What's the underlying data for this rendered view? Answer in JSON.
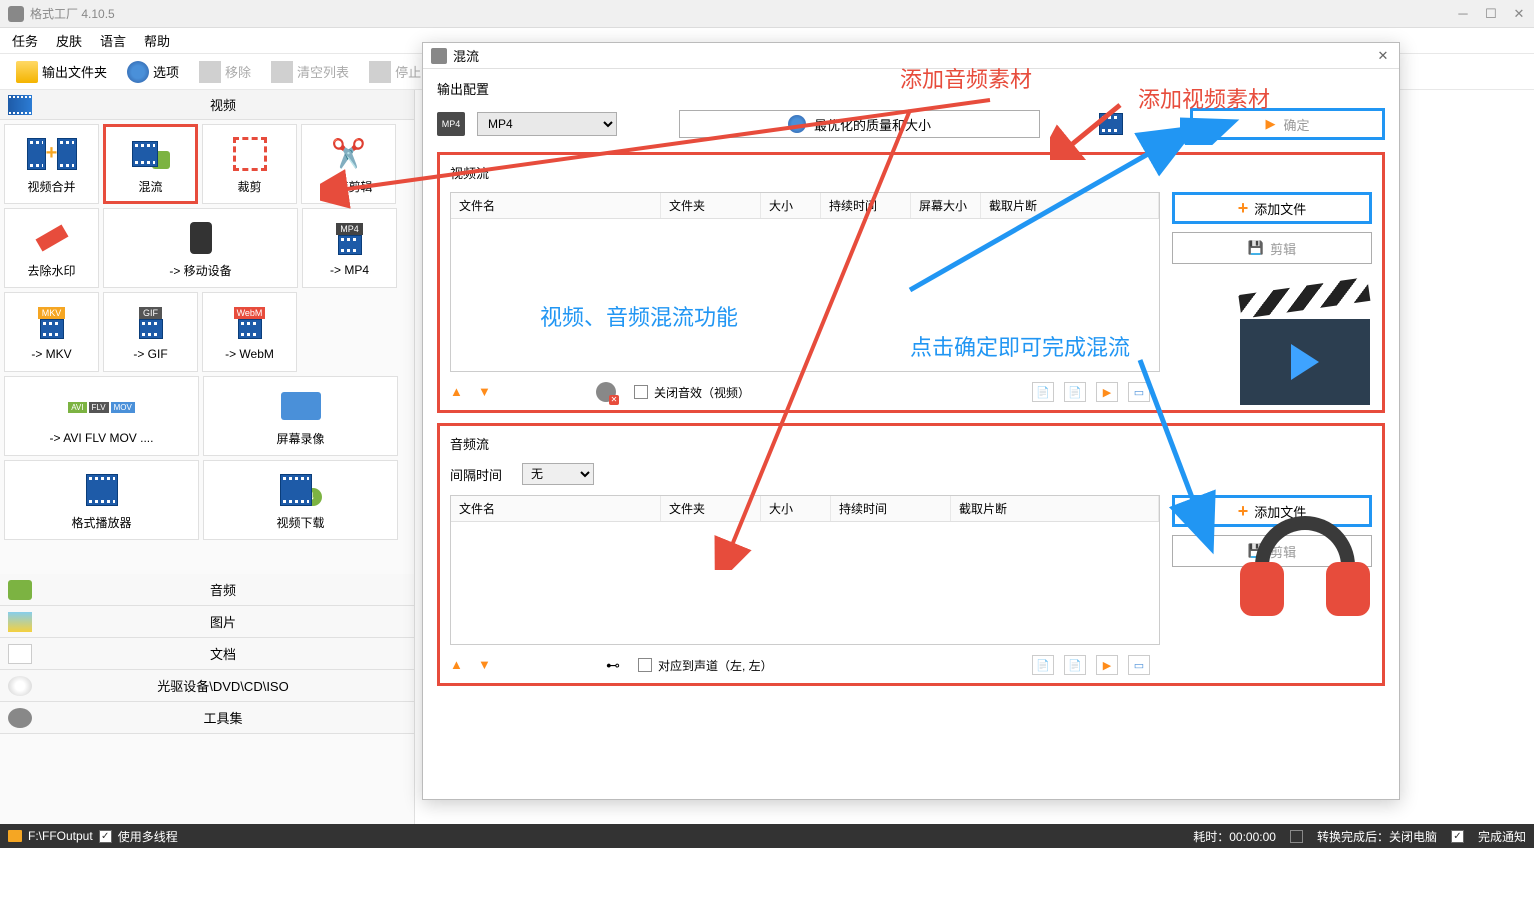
{
  "app": {
    "title": "格式工厂 4.10.5"
  },
  "menu": [
    "任务",
    "皮肤",
    "语言",
    "帮助"
  ],
  "toolbar": {
    "output_folder": "输出文件夹",
    "options": "选项",
    "remove": "移除",
    "clear_list": "清空列表",
    "stop": "停止"
  },
  "sidebar": {
    "video_header": "视频",
    "items": [
      {
        "label": "视频合并"
      },
      {
        "label": "混流"
      },
      {
        "label": "裁剪"
      },
      {
        "label": "快速剪辑"
      },
      {
        "label": "去除水印"
      },
      {
        "label": "-> 移动设备"
      },
      {
        "label": "-> MP4"
      },
      {
        "label": "-> MKV"
      },
      {
        "label": "-> GIF"
      },
      {
        "label": "-> WebM"
      },
      {
        "label": "-> AVI FLV MOV ...."
      },
      {
        "label": "屏幕录像"
      },
      {
        "label": "格式播放器"
      },
      {
        "label": "视频下载"
      }
    ],
    "categories": [
      "音频",
      "图片",
      "文档",
      "光驱设备\\DVD\\CD\\ISO",
      "工具集"
    ]
  },
  "dialog": {
    "title": "混流",
    "output_label": "输出配置",
    "format": "MP4",
    "quality": "最优化的质量和大小",
    "confirm": "确定",
    "video_stream": {
      "label": "视频流",
      "columns": [
        "文件名",
        "文件夹",
        "大小",
        "持续时间",
        "屏幕大小",
        "截取片断"
      ],
      "add_file": "添加文件",
      "edit": "剪辑",
      "mute_label": "关闭音效（视频）"
    },
    "audio_stream": {
      "label": "音频流",
      "interval_label": "间隔时间",
      "interval_value": "无",
      "columns": [
        "文件名",
        "文件夹",
        "大小",
        "持续时间",
        "截取片断"
      ],
      "add_file": "添加文件",
      "edit": "剪辑",
      "channel_label": "对应到声道（左, 左）"
    }
  },
  "annotations": {
    "add_audio": "添加音频素材",
    "add_video": "添加视频素材",
    "mux_feature": "视频、音频混流功能",
    "confirm_hint": "点击确定即可完成混流"
  },
  "statusbar": {
    "output_path": "F:\\FFOutput",
    "multithread": "使用多线程",
    "elapsed": "耗时：00:00:00",
    "shutdown": "转换完成后：关闭电脑",
    "notify": "完成通知"
  }
}
